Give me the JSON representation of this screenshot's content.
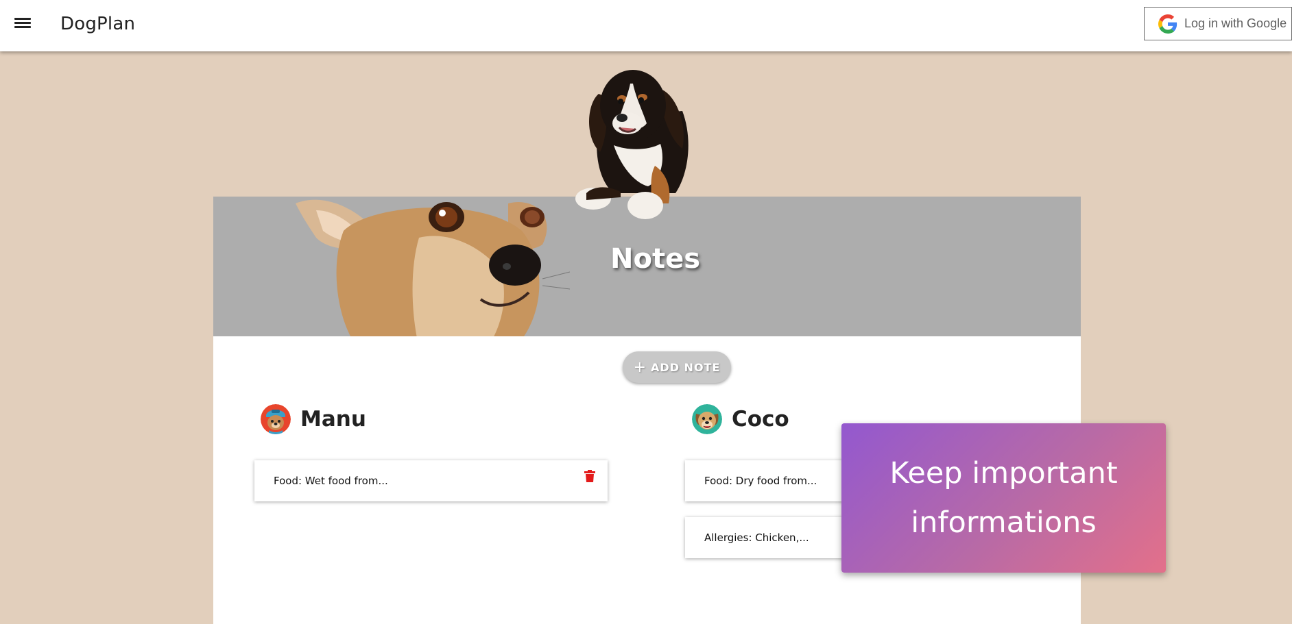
{
  "appbar": {
    "brand": "DogPlan",
    "login_label": "Log in with Google"
  },
  "page": {
    "title": "Notes",
    "add_note_label": "ADD NOTE"
  },
  "dogs": [
    {
      "name": "Manu",
      "avatar_icon": "dog-avatar-cap",
      "notes": [
        {
          "text": "Food: Wet food from..."
        }
      ]
    },
    {
      "name": "Coco",
      "avatar_icon": "dog-avatar-smile",
      "notes": [
        {
          "text": "Food: Dry food from..."
        },
        {
          "text": "Allergies: Chicken,..."
        }
      ]
    }
  ],
  "promo": {
    "line1": "Keep important",
    "line2": "informations"
  },
  "colors": {
    "background": "#e2cfbc",
    "hero": "#adadad",
    "delete": "#e31b1b",
    "promo_start": "#9358cf",
    "promo_end": "#e3708a"
  }
}
